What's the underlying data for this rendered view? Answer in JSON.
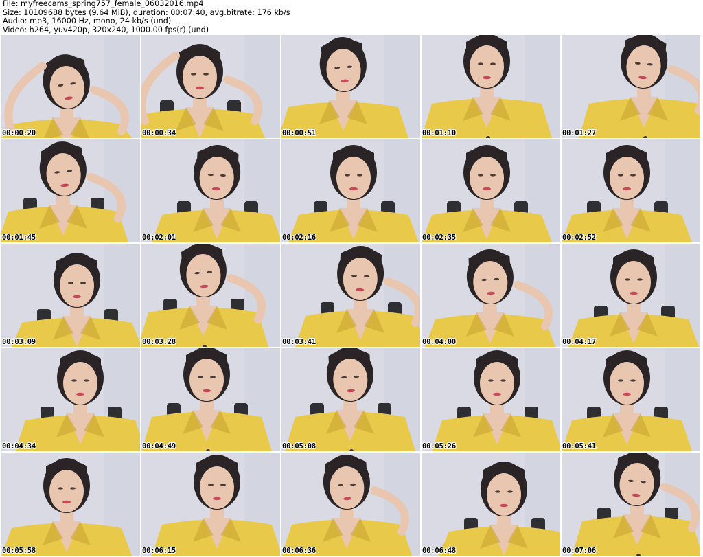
{
  "header": {
    "file_line": "File: myfreecams_spring757_female_06032016.mp4",
    "size_line": "Size: 10109688 bytes (9.64 MiB), duration: 00:07:40, avg.bitrate: 176 kb/s",
    "audio_line": "Audio: mp3, 16000 Hz, mono, 24 kb/s (und)",
    "video_line": "Video: h264, yuv420p, 320x240, 1000.00 fps(r) (und)"
  },
  "thumbnails": [
    {
      "timestamp": "00:00:20"
    },
    {
      "timestamp": "00:00:34"
    },
    {
      "timestamp": "00:00:51"
    },
    {
      "timestamp": "00:01:10"
    },
    {
      "timestamp": "00:01:27"
    },
    {
      "timestamp": "00:01:45"
    },
    {
      "timestamp": "00:02:01"
    },
    {
      "timestamp": "00:02:16"
    },
    {
      "timestamp": "00:02:35"
    },
    {
      "timestamp": "00:02:52"
    },
    {
      "timestamp": "00:03:09"
    },
    {
      "timestamp": "00:03:28"
    },
    {
      "timestamp": "00:03:41"
    },
    {
      "timestamp": "00:04:00"
    },
    {
      "timestamp": "00:04:17"
    },
    {
      "timestamp": "00:04:34"
    },
    {
      "timestamp": "00:04:49"
    },
    {
      "timestamp": "00:05:08"
    },
    {
      "timestamp": "00:05:26"
    },
    {
      "timestamp": "00:05:41"
    },
    {
      "timestamp": "00:05:58"
    },
    {
      "timestamp": "00:06:15"
    },
    {
      "timestamp": "00:06:36"
    },
    {
      "timestamp": "00:06:48"
    },
    {
      "timestamp": "00:07:06"
    }
  ],
  "colors": {
    "background": "#ffffff",
    "wall": "#d9dae3",
    "shirt": "#e8c94a",
    "shirt_shadow": "#c9a634",
    "skin": "#e9c6b0",
    "hair": "#2a2426",
    "chair": "#2e2e33",
    "lips": "#c9485a"
  }
}
